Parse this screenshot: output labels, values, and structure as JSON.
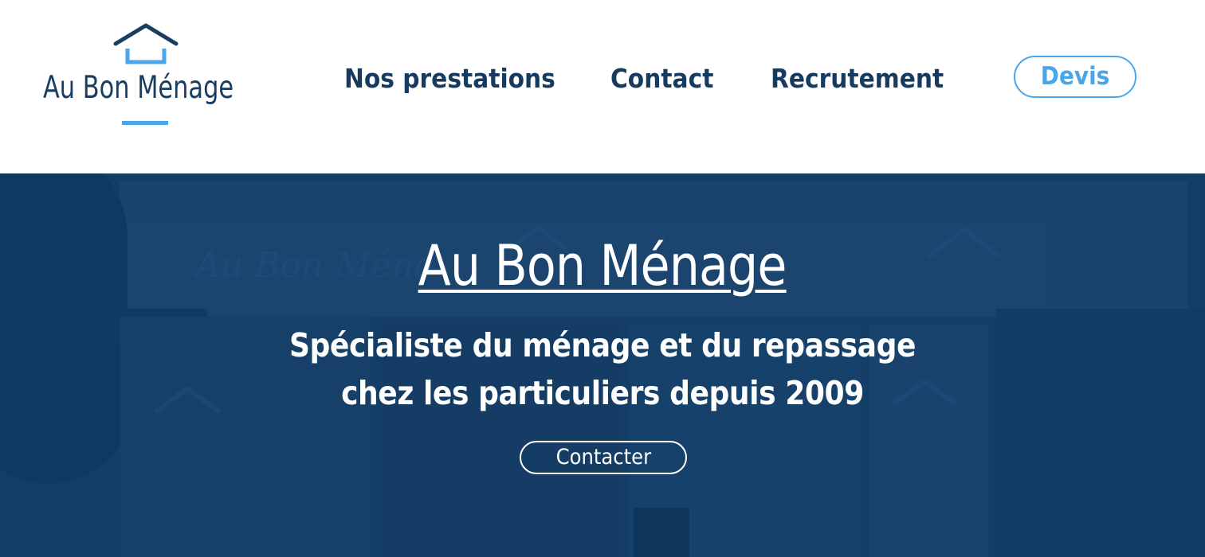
{
  "header": {
    "logo": {
      "text": "Au Bon Ménage",
      "icon": "house-roof-icon"
    },
    "nav": [
      {
        "label": "Nos prestations",
        "name": "nav-nos-prestations"
      },
      {
        "label": "Contact",
        "name": "nav-contact"
      },
      {
        "label": "Recrutement",
        "name": "nav-recrutement"
      }
    ],
    "devis_label": "Devis"
  },
  "hero": {
    "title": "Au Bon Ménage",
    "subtitle_line1": "Spécialiste du ménage et du repassage",
    "subtitle_line2": "chez les particuliers depuis 2009",
    "cta_label": "Contacter",
    "background_icon": "storefront-photo"
  },
  "colors": {
    "brand_navy": "#173b60",
    "accent_blue": "#4aa6ea",
    "hero_overlay": "#123c64",
    "white": "#ffffff"
  }
}
